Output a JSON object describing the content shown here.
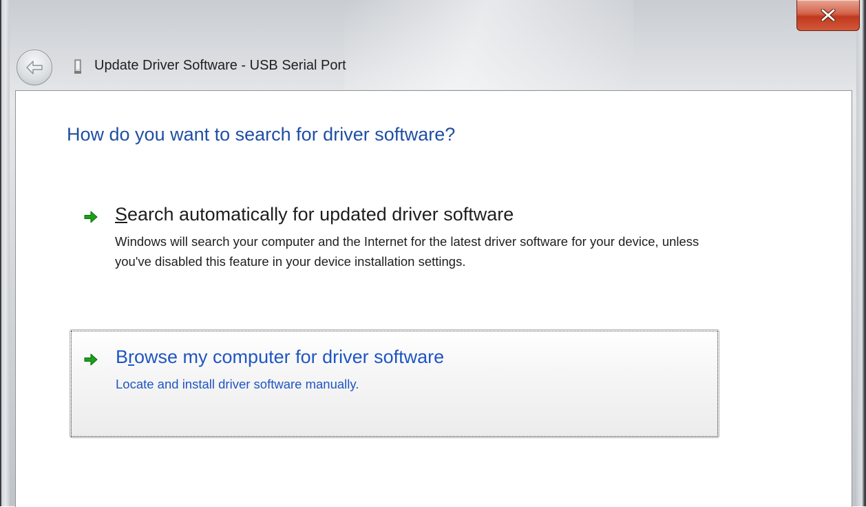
{
  "window": {
    "title": "Update Driver Software - USB Serial Port",
    "back_icon": "back-arrow-icon",
    "device_icon": "usb-device-icon",
    "close_icon": "close-x-icon",
    "close_color": "#c7432a"
  },
  "main": {
    "heading": "How do you want to search for driver software?",
    "options": [
      {
        "accel": "S",
        "title_rest": "earch automatically for updated driver software",
        "description": "Windows will search your computer and the Internet for the latest driver software for your device, unless you've disabled this feature in your device installation settings.",
        "icon": "green-arrow-icon"
      },
      {
        "title_pre": "B",
        "accel": "r",
        "title_rest": "owse my computer for driver software",
        "description": "Locate and install driver software manually.",
        "icon": "green-arrow-icon",
        "focused": true
      }
    ]
  },
  "colors": {
    "heading": "#1f4fa3",
    "link": "#1f55c3",
    "arrow": "#1aa11a"
  }
}
